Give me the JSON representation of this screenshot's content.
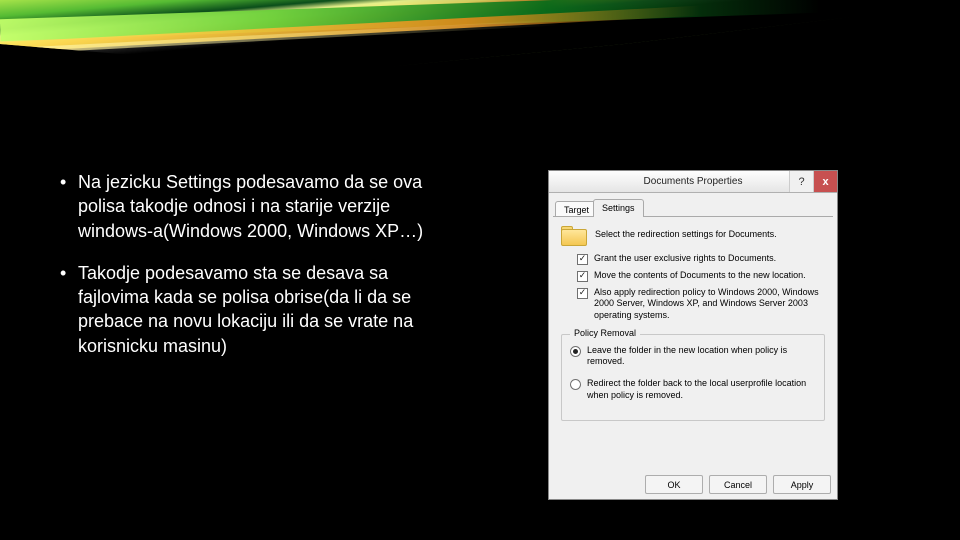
{
  "slide": {
    "bullets": [
      "Na jezicku Settings podesavamo da se ova polisa takodje odnosi i na starije verzije windows-a(Windows 2000, Windows XP…)",
      "Takodje podesavamo sta se desava sa fajlovima kada se polisa obrise(da li da se prebace na novu lokaciju ili da se vrate na korisnicku masinu)"
    ]
  },
  "dialog": {
    "title": "Documents Properties",
    "help": "?",
    "close": "x",
    "tabs": {
      "target": "Target",
      "settings": "Settings"
    },
    "header": "Select the redirection settings for Documents.",
    "checkboxes": {
      "c1": "Grant the user exclusive rights to Documents.",
      "c2": "Move the contents of Documents to the new location.",
      "c3": "Also apply redirection policy to Windows 2000, Windows 2000 Server, Windows XP, and Windows Server 2003 operating systems."
    },
    "group": {
      "legend": "Policy Removal",
      "r1": "Leave the folder in the new location when policy is removed.",
      "r2": "Redirect the folder back to the local userprofile location when policy is removed."
    },
    "buttons": {
      "ok": "OK",
      "cancel": "Cancel",
      "apply": "Apply"
    }
  }
}
